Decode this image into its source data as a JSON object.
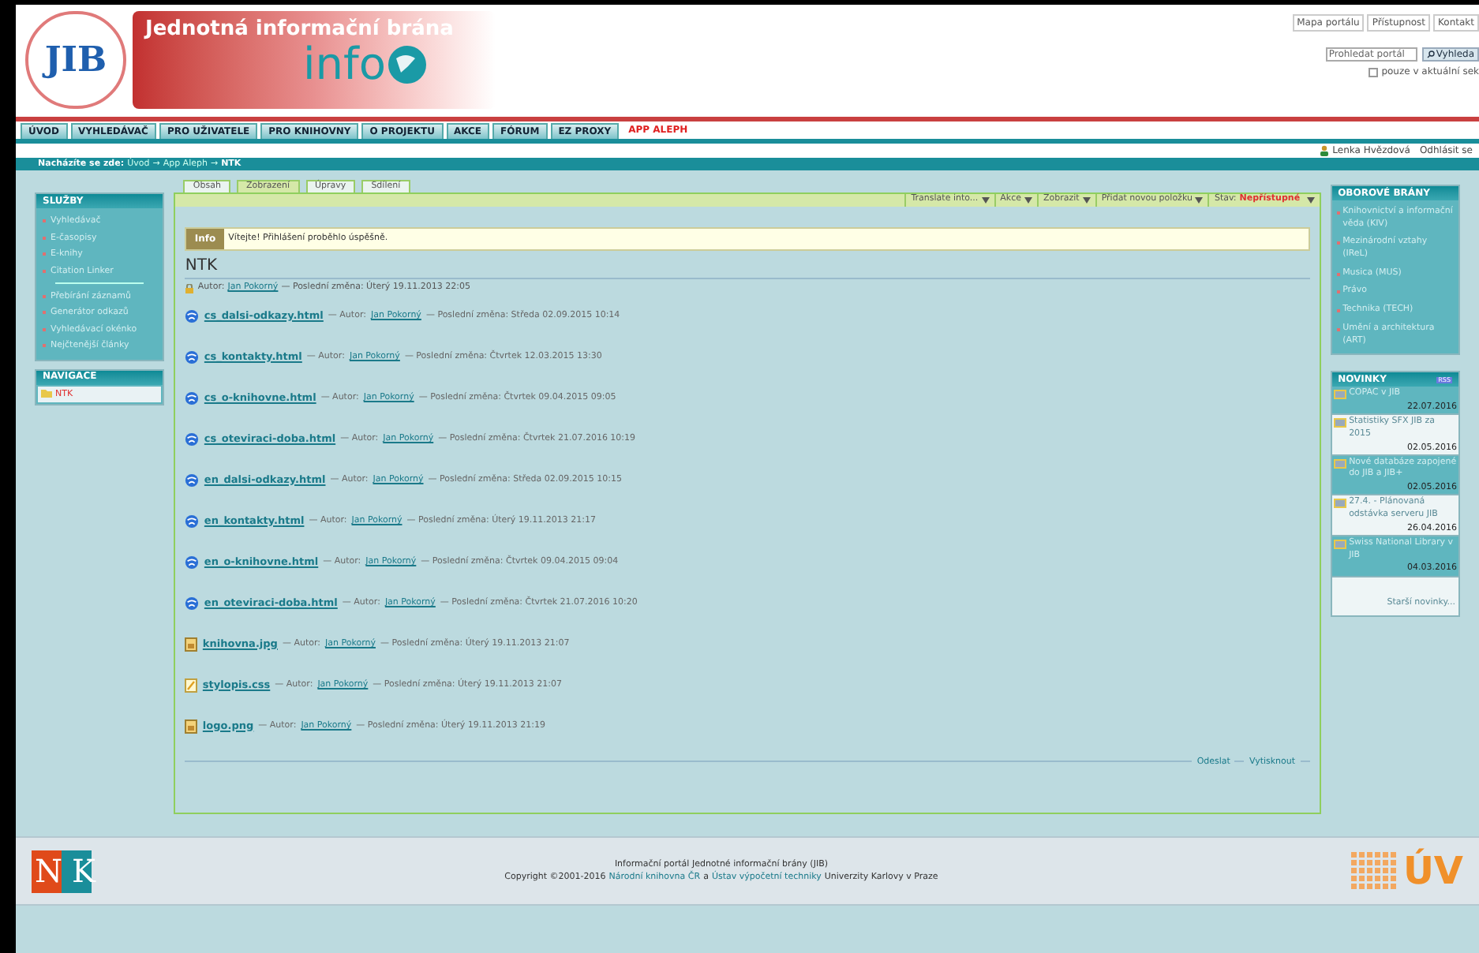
{
  "header": {
    "logo_text": "JIB",
    "banner_title": "Jednotná informační brána",
    "banner_word": "info",
    "top_links": [
      "Mapa portálu",
      "Přístupnost",
      "Kontakt"
    ],
    "search": {
      "placeholder": "Prohledat portál",
      "button": "Vyhleda"
    },
    "scope_checkbox": {
      "label": "pouze v aktuální sek",
      "checked": false
    }
  },
  "nav_tabs": [
    {
      "label": "ÚVOD",
      "selected": false
    },
    {
      "label": "VYHLEDÁVAČ",
      "selected": false
    },
    {
      "label": "PRO UŽIVATELE",
      "selected": false
    },
    {
      "label": "PRO KNIHOVNY",
      "selected": false
    },
    {
      "label": "O PROJEKTU",
      "selected": false
    },
    {
      "label": "AKCE",
      "selected": false
    },
    {
      "label": "FÓRUM",
      "selected": false
    },
    {
      "label": "EZ PROXY",
      "selected": false
    },
    {
      "label": "APP ALEPH",
      "selected": true
    }
  ],
  "user": {
    "name": "Lenka Hvězdová",
    "logout": "Odhlásit se"
  },
  "breadcrumb": {
    "label": "Nacházíte se zde:",
    "separator": "→",
    "items": [
      "Úvod",
      "App Aleph",
      "NTK"
    ]
  },
  "left_sidebar": {
    "services": {
      "title": "SLUŽBY",
      "groups": [
        [
          "Vyhledávač",
          "E-časopisy",
          "E-knihy",
          "Citation Linker"
        ],
        [
          "Přebírání záznamů",
          "Generátor odkazů",
          "Vyhledávací okénko",
          "Nejčtenější články"
        ]
      ]
    },
    "navigation": {
      "title": "NAVIGACE",
      "items": [
        {
          "label": "NTK",
          "selected": true
        }
      ]
    }
  },
  "content": {
    "tabs": [
      {
        "label": "Obsah",
        "selected": false
      },
      {
        "label": "Zobrazení",
        "selected": true
      },
      {
        "label": "Úpravy",
        "selected": false
      },
      {
        "label": "Sdílení",
        "selected": false
      }
    ],
    "actions": [
      "Translate into...",
      "Akce",
      "Zobrazit",
      "Přidat novou položku"
    ],
    "state": {
      "label": "Stav:",
      "value": "Nepřístupné"
    },
    "info": {
      "badge": "Info",
      "message": "Vítejte! Přihlášení proběhlo úspěšně."
    },
    "title": "NTK",
    "meta": {
      "author_label": "Autor:",
      "author": "Jan Pokorný",
      "modified": "— Poslední změna: Úterý 19.11.2013 22:05"
    },
    "items": [
      {
        "name": "cs_dalsi-odkazy.html",
        "kind": "page",
        "author_label": "— Autor:",
        "author": "Jan Pokorný",
        "modified": "— Poslední změna: Středa 02.09.2015 10:14"
      },
      {
        "name": "cs_kontakty.html",
        "kind": "page",
        "author_label": "— Autor:",
        "author": "Jan Pokorný",
        "modified": "— Poslední změna: Čtvrtek 12.03.2015 13:30"
      },
      {
        "name": "cs_o-knihovne.html",
        "kind": "page",
        "author_label": "— Autor:",
        "author": "Jan Pokorný",
        "modified": "— Poslední změna: Čtvrtek 09.04.2015 09:05"
      },
      {
        "name": "cs_oteviraci-doba.html",
        "kind": "page",
        "author_label": "— Autor:",
        "author": "Jan Pokorný",
        "modified": "— Poslední změna: Čtvrtek 21.07.2016 10:19"
      },
      {
        "name": "en_dalsi-odkazy.html",
        "kind": "page",
        "author_label": "— Autor:",
        "author": "Jan Pokorný",
        "modified": "— Poslední změna: Středa 02.09.2015 10:15"
      },
      {
        "name": "en_kontakty.html",
        "kind": "page",
        "author_label": "— Autor:",
        "author": "Jan Pokorný",
        "modified": "— Poslední změna: Úterý 19.11.2013 21:17"
      },
      {
        "name": "en_o-knihovne.html",
        "kind": "page",
        "author_label": "— Autor:",
        "author": "Jan Pokorný",
        "modified": "— Poslední změna: Čtvrtek 09.04.2015 09:04"
      },
      {
        "name": "en_oteviraci-doba.html",
        "kind": "page",
        "author_label": "— Autor:",
        "author": "Jan Pokorný",
        "modified": "— Poslední změna: Čtvrtek 21.07.2016 10:20"
      },
      {
        "name": "knihovna.jpg",
        "kind": "image",
        "author_label": "— Autor:",
        "author": "Jan Pokorný",
        "modified": "— Poslední změna: Úterý 19.11.2013 21:07"
      },
      {
        "name": "stylopis.css",
        "kind": "file",
        "author_label": "— Autor:",
        "author": "Jan Pokorný",
        "modified": "— Poslední změna: Úterý 19.11.2013 21:07"
      },
      {
        "name": "logo.png",
        "kind": "image",
        "author_label": "— Autor:",
        "author": "Jan Pokorný",
        "modified": "— Poslední změna: Úterý 19.11.2013 21:19"
      }
    ],
    "footer_links": [
      "Odeslat",
      "Vytisknout"
    ]
  },
  "right_sidebar": {
    "portals": {
      "title": "OBOROVÉ BRÁNY",
      "items": [
        "Knihovnictví a informační věda (KIV)",
        "Mezinárodní vztahy (IReL)",
        "Musica (MUS)",
        "Právo",
        "Technika (TECH)",
        "Umění a architektura (ART)"
      ]
    },
    "news": {
      "title": "NOVINKY",
      "rss": "RSS",
      "items": [
        {
          "title": "COPAC v JIB",
          "date": "22.07.2016"
        },
        {
          "title": "Statistiky SFX JIB za 2015",
          "date": "02.05.2016"
        },
        {
          "title": "Nové databáze zapojené do JIB a JIB+",
          "date": "02.05.2016"
        },
        {
          "title": "27.4. - Plánovaná odstávka serveru JIB",
          "date": "26.04.2016"
        },
        {
          "title": "Swiss National Library v JIB",
          "date": "04.03.2016"
        }
      ],
      "more": "Starší novinky..."
    }
  },
  "footer": {
    "line1": "Informační portál Jednotné informační brány (JIB)",
    "line2": [
      {
        "kind": "text",
        "text": "Copyright ©2001-2016"
      },
      {
        "kind": "link",
        "text": "Národní knihovna ČR"
      },
      {
        "kind": "text",
        "text": "a"
      },
      {
        "kind": "link",
        "text": "Ústav výpočetní techniky"
      },
      {
        "kind": "text",
        "text": "Univerzity Karlovy v Praze"
      }
    ],
    "left_logo": "NK",
    "right_logo": "ÚV"
  }
}
